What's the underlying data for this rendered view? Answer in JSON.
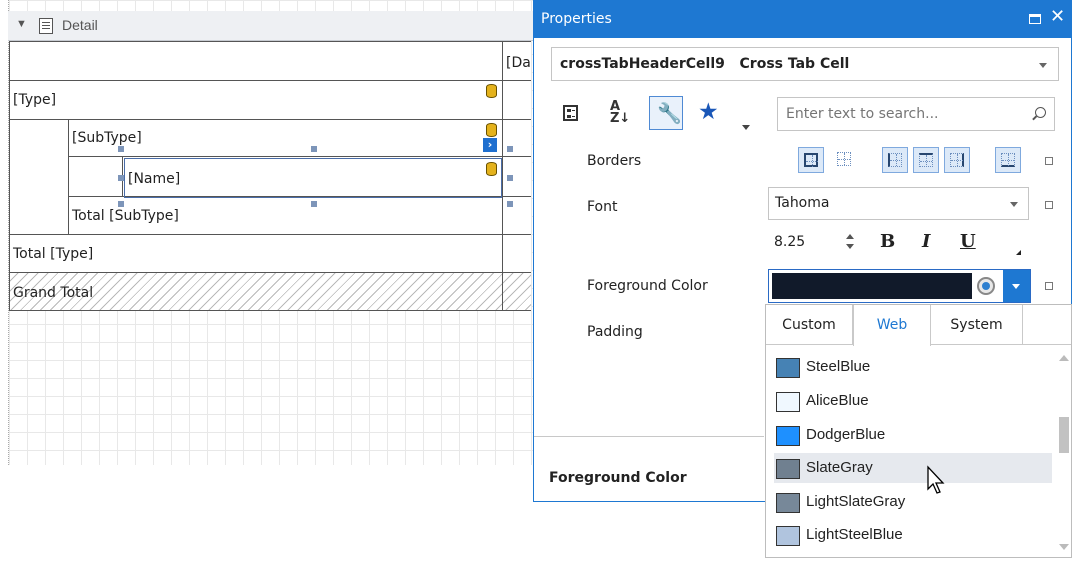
{
  "designer": {
    "band_name": "Detail",
    "rows": {
      "type": "[Type]",
      "subtype": "[SubType]",
      "name": "[Name]",
      "total_subtype": "Total [SubType]",
      "total_type": "Total [Type]",
      "grand_total": "Grand Total",
      "data_column_header": "[Da"
    },
    "icons": [
      "collapse-triangle-icon",
      "band-icon",
      "database-field-icon",
      "smart-tag-icon"
    ]
  },
  "properties": {
    "title": "Properties",
    "object_name": "crossTabHeaderCell9",
    "object_type": "Cross Tab Cell",
    "search_placeholder": "Enter text to search...",
    "labels": {
      "borders": "Borders",
      "font": "Font",
      "foreground_color": "Foreground Color",
      "padding": "Padding"
    },
    "font_name": "Tahoma",
    "font_size": "8.25",
    "bold_label": "B",
    "italic_label": "I",
    "underline_label": "U",
    "foreground_color_value": "#111a2a",
    "description_title": "Foreground Color"
  },
  "color_popup": {
    "tabs": [
      "Custom",
      "Web",
      "System"
    ],
    "active_tab": "Web",
    "colors": [
      {
        "name": "SteelBlue",
        "hex": "#4682b4"
      },
      {
        "name": "AliceBlue",
        "hex": "#f0f8ff"
      },
      {
        "name": "DodgerBlue",
        "hex": "#1e90ff"
      },
      {
        "name": "SlateGray",
        "hex": "#708090"
      },
      {
        "name": "LightSlateGray",
        "hex": "#778899"
      },
      {
        "name": "LightSteelBlue",
        "hex": "#b0c4de"
      }
    ],
    "hovered": "SlateGray"
  },
  "colors": {
    "accent": "#1e78d2",
    "panel_header": "#1e78d2"
  }
}
